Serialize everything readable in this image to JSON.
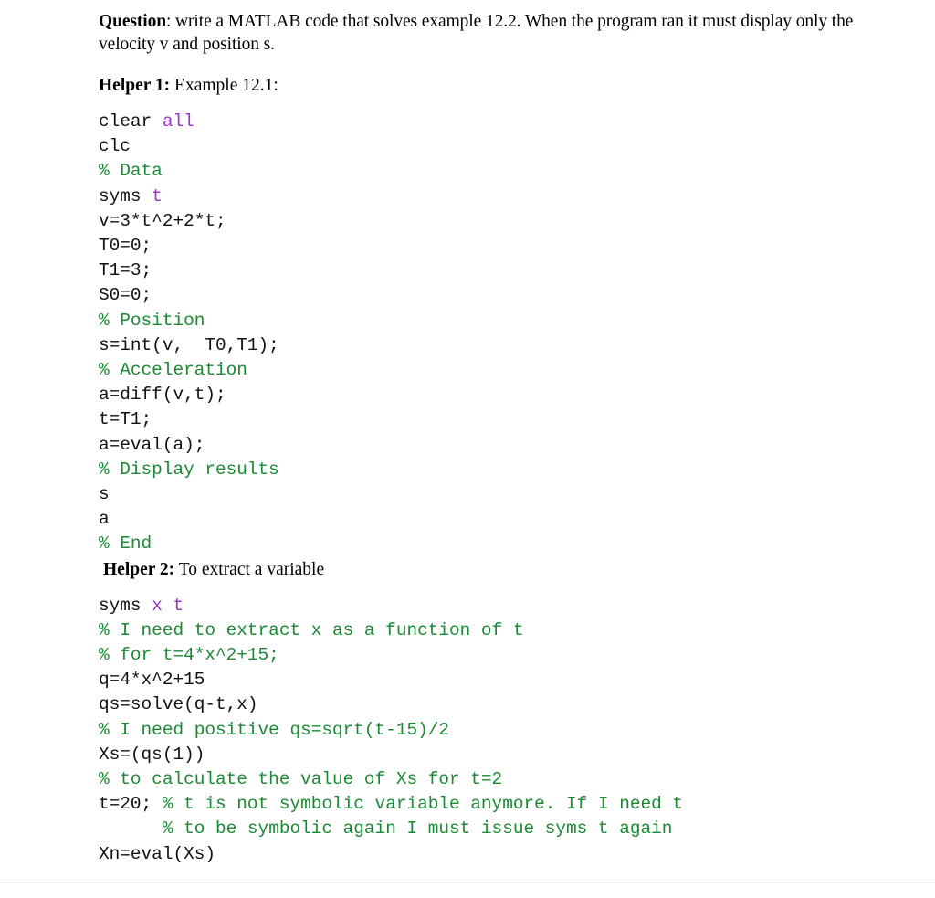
{
  "document": {
    "background_color": "#ffffff",
    "text_color": "#000000",
    "comment_color": "#1a8a33",
    "keyword_color": "#9933cc"
  },
  "question": {
    "lead": "Question",
    "body": ": write a MATLAB code that solves example 12.2. When the program ran it must display only the velocity v and position s."
  },
  "helper1": {
    "lead": "Helper 1:",
    "title": " Example 12.1:"
  },
  "code1": {
    "lines": [
      [
        {
          "t": "clear ",
          "c": "plain"
        },
        {
          "t": "all",
          "c": "keyword"
        }
      ],
      [
        {
          "t": "clc",
          "c": "plain"
        }
      ],
      [
        {
          "t": "% Data",
          "c": "comment"
        }
      ],
      [
        {
          "t": "syms ",
          "c": "plain"
        },
        {
          "t": "t",
          "c": "keyword"
        }
      ],
      [
        {
          "t": "v=3*t^2+2*t;",
          "c": "plain"
        }
      ],
      [
        {
          "t": "T0=0;",
          "c": "plain"
        }
      ],
      [
        {
          "t": "T1=3;",
          "c": "plain"
        }
      ],
      [
        {
          "t": "S0=0;",
          "c": "plain"
        }
      ],
      [
        {
          "t": "% Position",
          "c": "comment"
        }
      ],
      [
        {
          "t": "s=int(v,  T0,T1);",
          "c": "plain"
        }
      ],
      [
        {
          "t": "% Acceleration",
          "c": "comment"
        }
      ],
      [
        {
          "t": "a=diff(v,t);",
          "c": "plain"
        }
      ],
      [
        {
          "t": "t=T1;",
          "c": "plain"
        }
      ],
      [
        {
          "t": "a=eval(a);",
          "c": "plain"
        }
      ],
      [
        {
          "t": "% Display results",
          "c": "comment"
        }
      ],
      [
        {
          "t": "s",
          "c": "plain"
        }
      ],
      [
        {
          "t": "a",
          "c": "plain"
        }
      ],
      [
        {
          "t": "% End",
          "c": "comment"
        }
      ]
    ]
  },
  "helper2": {
    "lead": "Helper 2:",
    "title": " To extract a variable"
  },
  "code2": {
    "lines": [
      [
        {
          "t": "syms ",
          "c": "plain"
        },
        {
          "t": "x t",
          "c": "keyword"
        }
      ],
      [
        {
          "t": "% I need to extract x as a function of t",
          "c": "comment"
        }
      ],
      [
        {
          "t": "% for t=4*x^2+15;",
          "c": "comment"
        }
      ],
      [
        {
          "t": "q=4*x^2+15",
          "c": "plain"
        }
      ],
      [
        {
          "t": "qs=solve(q-t,x)",
          "c": "plain"
        }
      ],
      [
        {
          "t": "% I need positive qs=sqrt(t-15)/2",
          "c": "comment"
        }
      ],
      [
        {
          "t": "Xs=(qs(1))",
          "c": "plain"
        }
      ],
      [
        {
          "t": "% to calculate the value of Xs for t=2",
          "c": "comment"
        }
      ],
      [
        {
          "t": "t=20; ",
          "c": "plain"
        },
        {
          "t": "% t is not symbolic variable anymore. If I need t",
          "c": "comment"
        }
      ],
      [
        {
          "t": "      ",
          "c": "plain"
        },
        {
          "t": "% to be symbolic again I must issue syms t again",
          "c": "comment"
        }
      ],
      [
        {
          "t": "Xn=eval(Xs)",
          "c": "plain"
        }
      ]
    ]
  }
}
